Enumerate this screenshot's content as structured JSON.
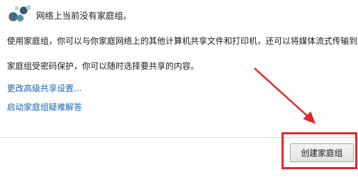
{
  "homegroup": {
    "icon": "homegroup-icon",
    "heading": "网络上当前没有家庭组。",
    "description_line1": "使用家庭组，你可以与你家庭网络上的其他计算机共享文件和打印机，还可以将媒体流式传输到",
    "description_line2": "家庭组受密码保护，你可以随时选择要共享的内容。",
    "links": {
      "advanced_sharing": "更改高级共享设置...",
      "troubleshooter": "启动家庭组疑难解答"
    },
    "create_button_label": "创建家庭组"
  },
  "colors": {
    "link": "#1e63b0",
    "annotation": "#e0272a",
    "icon_dark": "#3f6e84",
    "icon_light": "#b9cfd8"
  }
}
